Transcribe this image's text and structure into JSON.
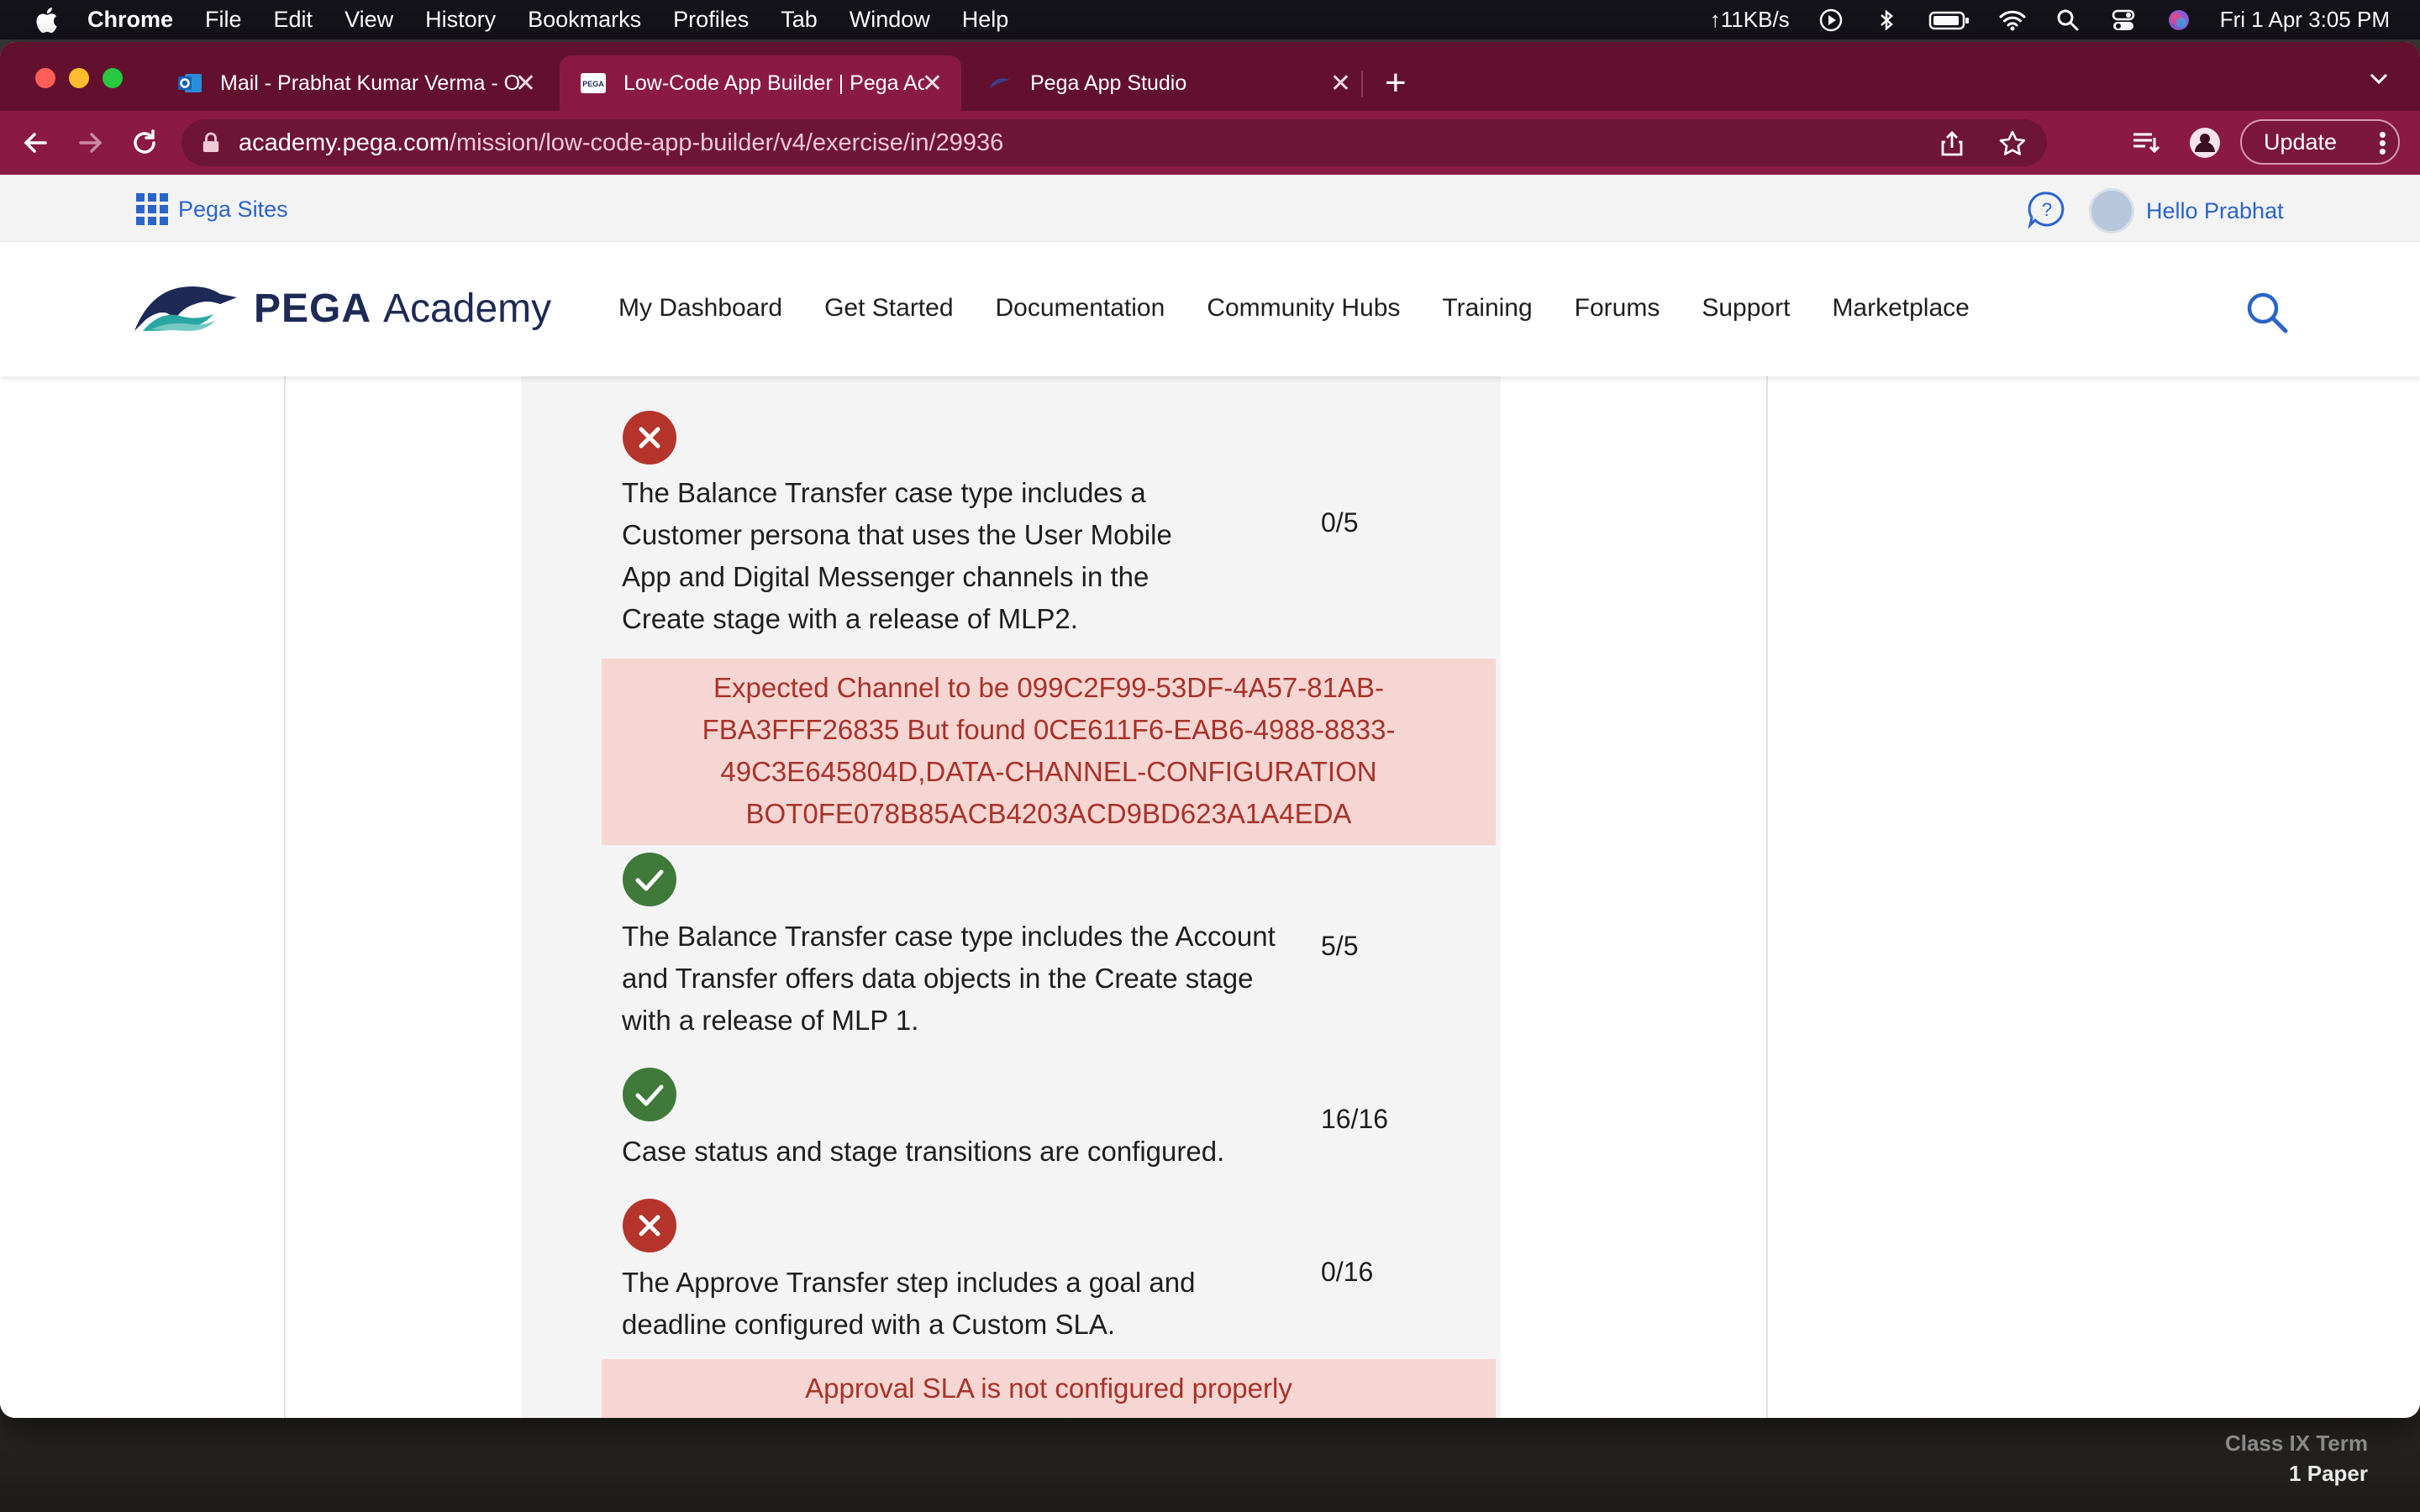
{
  "menubar": {
    "items": [
      "Chrome",
      "File",
      "Edit",
      "View",
      "History",
      "Bookmarks",
      "Profiles",
      "Tab",
      "Window",
      "Help"
    ],
    "net_speed": "↑11KB/s",
    "datetime": "Fri 1 Apr  3:05 PM"
  },
  "tabs": [
    {
      "label": "Mail - Prabhat Kumar Verma - Outlook",
      "active": false
    },
    {
      "label": "Low-Code App Builder | Pega Academy",
      "active": true
    },
    {
      "label": "Pega App Studio",
      "active": false
    }
  ],
  "address_bar": {
    "domain": "academy.pega.com",
    "path": "/mission/low-code-app-builder/v4/exercise/in/29936"
  },
  "update_label": "Update",
  "utility": {
    "pega_sites": "Pega Sites",
    "hello": "Hello Prabhat"
  },
  "header": {
    "logo_pega": "PEGA",
    "logo_academy": "Academy",
    "nav": [
      "My Dashboard",
      "Get Started",
      "Documentation",
      "Community Hubs",
      "Training",
      "Forums",
      "Support",
      "Marketplace"
    ]
  },
  "results": [
    {
      "status": "fail",
      "description": "The Balance Transfer case type includes a Customer persona that uses the User Mobile App and Digital Messenger channels in the Create stage with a release of MLP2.",
      "score": "0/5",
      "error": "Expected Channel to be 099C2F99-53DF-4A57-81AB-FBA3FFF26835 But found 0CE611F6-EAB6-4988-8833-49C3E645804D,DATA-CHANNEL-CONFIGURATION BOT0FE078B85ACB4203ACD9BD623A1A4EDA"
    },
    {
      "status": "pass",
      "description": "The Balance Transfer case type includes the Account and Transfer offers data objects in the Create stage with a release of MLP 1.",
      "score": "5/5"
    },
    {
      "status": "pass",
      "description": "Case status and stage transitions are configured.",
      "score": "16/16"
    },
    {
      "status": "fail",
      "description": "The Approve Transfer step includes a goal and deadline configured with a Custom SLA.",
      "score": "0/16",
      "error": "Approval SLA is not configured properly"
    }
  ],
  "desktop": {
    "line1": "Class IX Term",
    "line2": "1 Paper"
  },
  "colors": {
    "tabstrip": "#63102f",
    "toolbar": "#8a1a44",
    "fail": "#b5342b",
    "pass": "#3f7a3a",
    "error_bg": "#f6d6d2",
    "error_text": "#a8322b",
    "link": "#2b64c9"
  }
}
